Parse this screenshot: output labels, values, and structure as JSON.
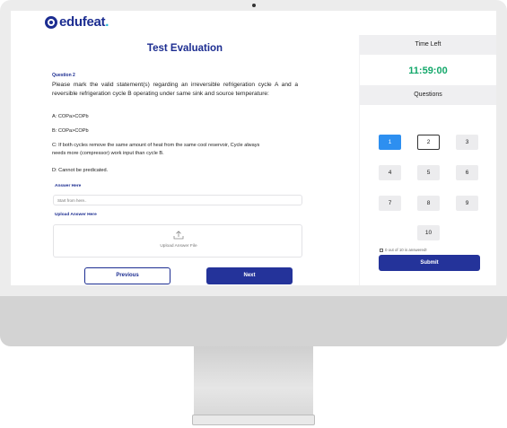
{
  "brand": {
    "name": "edufeat",
    "dot": "."
  },
  "page": {
    "title": "Test Evaluation"
  },
  "question": {
    "number_label": "Question 2",
    "text": "Please mark the valid statement(s) regarding an irreversible refrigeration cycle A and a reversible refrigeration cycle B operating under same sink and source temperature:",
    "options": [
      {
        "label": "A:  COPa>COPb"
      },
      {
        "label": "B:  COPa>COPb"
      },
      {
        "label": "C:  If both cycles remove the same amount of heat from the same cool reservoir, Cycle always needs more (compressor) work input than cycle B."
      },
      {
        "label": "D:  Cannot be predicated."
      }
    ]
  },
  "answer": {
    "label": "Answer Here",
    "placeholder": "Start from here..",
    "value": ""
  },
  "upload": {
    "label": "Upload Answer Here",
    "box_label": "Upload Answer File",
    "icon": "upload-icon"
  },
  "nav": {
    "previous": "Previous",
    "next": "Next"
  },
  "sidebar": {
    "time_left_label": "Time Left",
    "timer": "11:59:00",
    "questions_label": "Questions",
    "question_buttons": [
      "1",
      "2",
      "3",
      "4",
      "5",
      "6",
      "7",
      "8",
      "9",
      "10"
    ],
    "answered_text": "0 out of 10 is answered!",
    "submit": "Submit"
  },
  "colors": {
    "brand": "#1c2d91",
    "primary_button": "#24339a",
    "timer": "#14a86b",
    "active_question": "#2d8ff0"
  }
}
